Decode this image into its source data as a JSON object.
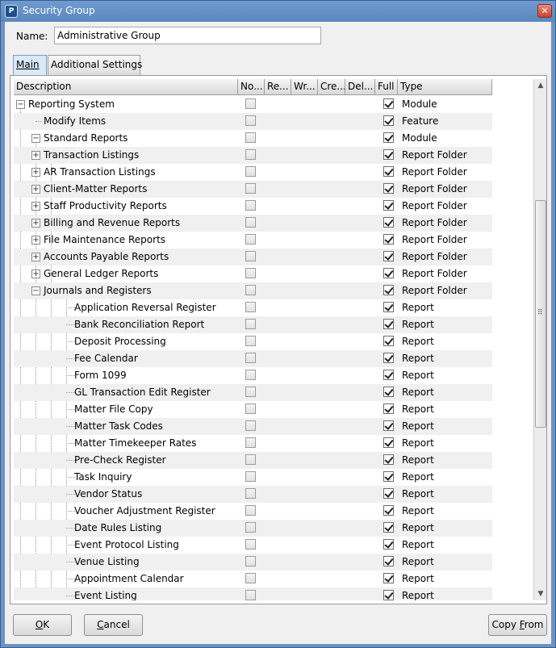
{
  "window": {
    "title": "Security Group",
    "close_symbol": "✕"
  },
  "form": {
    "name_label": "Name:",
    "name_value": "Administrative Group"
  },
  "tabs": [
    {
      "label": "Main",
      "active": true
    },
    {
      "label": "Additional Settings",
      "active": false
    }
  ],
  "columns": [
    "Description",
    "No...",
    "Re...",
    "Wr...",
    "Cre...",
    "Del...",
    "Full",
    "Type"
  ],
  "rows": [
    {
      "label": "Reporting System",
      "level": 0,
      "expander": "−",
      "none": false,
      "full": true,
      "type": "Module"
    },
    {
      "label": "Modify Items",
      "level": 1,
      "expander": "",
      "none": false,
      "full": true,
      "type": "Feature"
    },
    {
      "label": "Standard Reports",
      "level": 1,
      "expander": "−",
      "none": false,
      "full": true,
      "type": "Module"
    },
    {
      "label": "Transaction Listings",
      "level": 2,
      "expander": "+",
      "none": false,
      "full": true,
      "type": "Report Folder"
    },
    {
      "label": "AR Transaction Listings",
      "level": 2,
      "expander": "+",
      "none": false,
      "full": true,
      "type": "Report Folder"
    },
    {
      "label": "Client-Matter Reports",
      "level": 2,
      "expander": "+",
      "none": false,
      "full": true,
      "type": "Report Folder"
    },
    {
      "label": "Staff Productivity Reports",
      "level": 2,
      "expander": "+",
      "none": false,
      "full": true,
      "type": "Report Folder"
    },
    {
      "label": "Billing and Revenue Reports",
      "level": 2,
      "expander": "+",
      "none": false,
      "full": true,
      "type": "Report Folder"
    },
    {
      "label": "File Maintenance Reports",
      "level": 2,
      "expander": "+",
      "none": false,
      "full": true,
      "type": "Report Folder"
    },
    {
      "label": "Accounts Payable Reports",
      "level": 2,
      "expander": "+",
      "none": false,
      "full": true,
      "type": "Report Folder"
    },
    {
      "label": "General Ledger Reports",
      "level": 2,
      "expander": "+",
      "none": false,
      "full": true,
      "type": "Report Folder"
    },
    {
      "label": "Journals and Registers",
      "level": 2,
      "expander": "−",
      "none": false,
      "full": true,
      "type": "Report Folder"
    },
    {
      "label": "Application Reversal Register",
      "level": 3,
      "expander": "",
      "none": false,
      "full": true,
      "type": "Report"
    },
    {
      "label": "Bank Reconciliation Report",
      "level": 3,
      "expander": "",
      "none": false,
      "full": true,
      "type": "Report"
    },
    {
      "label": "Deposit Processing",
      "level": 3,
      "expander": "",
      "none": false,
      "full": true,
      "type": "Report"
    },
    {
      "label": "Fee Calendar",
      "level": 3,
      "expander": "",
      "none": false,
      "full": true,
      "type": "Report"
    },
    {
      "label": "Form 1099",
      "level": 3,
      "expander": "",
      "none": false,
      "full": true,
      "type": "Report"
    },
    {
      "label": "GL Transaction Edit Register",
      "level": 3,
      "expander": "",
      "none": false,
      "full": true,
      "type": "Report"
    },
    {
      "label": "Matter File Copy",
      "level": 3,
      "expander": "",
      "none": false,
      "full": true,
      "type": "Report"
    },
    {
      "label": "Matter Task Codes",
      "level": 3,
      "expander": "",
      "none": false,
      "full": true,
      "type": "Report"
    },
    {
      "label": "Matter Timekeeper Rates",
      "level": 3,
      "expander": "",
      "none": false,
      "full": true,
      "type": "Report"
    },
    {
      "label": "Pre-Check Register",
      "level": 3,
      "expander": "",
      "none": false,
      "full": true,
      "type": "Report"
    },
    {
      "label": "Task Inquiry",
      "level": 3,
      "expander": "",
      "none": false,
      "full": true,
      "type": "Report"
    },
    {
      "label": "Vendor Status",
      "level": 3,
      "expander": "",
      "none": false,
      "full": true,
      "type": "Report"
    },
    {
      "label": "Voucher Adjustment Register",
      "level": 3,
      "expander": "",
      "none": false,
      "full": true,
      "type": "Report"
    },
    {
      "label": "Date Rules Listing",
      "level": 3,
      "expander": "",
      "none": false,
      "full": true,
      "type": "Report"
    },
    {
      "label": "Event Protocol Listing",
      "level": 3,
      "expander": "",
      "none": false,
      "full": true,
      "type": "Report"
    },
    {
      "label": "Venue Listing",
      "level": 3,
      "expander": "",
      "none": false,
      "full": true,
      "type": "Report"
    },
    {
      "label": "Appointment Calendar",
      "level": 3,
      "expander": "",
      "none": false,
      "full": true,
      "type": "Report"
    },
    {
      "label": "Event Listing",
      "level": 3,
      "expander": "",
      "none": false,
      "full": true,
      "type": "Report"
    }
  ],
  "scrollbar": {
    "up_symbol": "▲",
    "down_symbol": "▼",
    "grip_symbol": "⠿"
  },
  "buttons": {
    "ok": {
      "mnemonic": "O",
      "rest": "K"
    },
    "cancel": {
      "mnemonic": "C",
      "rest": "ancel"
    },
    "copy_from": {
      "text": "Copy ",
      "mnemonic": "F",
      "rest": "rom"
    }
  },
  "icons": {
    "app": "app-logo-icon",
    "close": "close-icon",
    "check": "checkmark-icon",
    "expand": "plus-icon",
    "collapse": "minus-icon"
  },
  "colors": {
    "titlebar": "#6b93c5",
    "tab_active": "#d9e9f8",
    "row_alt": "#f0f0f0"
  }
}
